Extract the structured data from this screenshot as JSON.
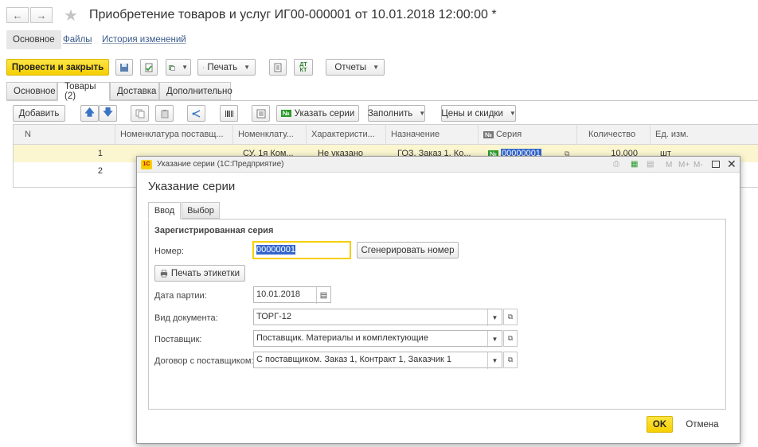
{
  "window": {
    "title": "Приобретение товаров и услуг ИГ00-000001 от 10.01.2018 12:00:00 *"
  },
  "nav_links": [
    "Основное",
    "Файлы",
    "История изменений"
  ],
  "toolbar": {
    "post_close": "Провести и закрыть",
    "print": "Печать",
    "reports": "Отчеты"
  },
  "tabs": [
    "Основное",
    "Товары (2)",
    "Доставка",
    "Дополнительно"
  ],
  "grid_toolbar": {
    "add": "Добавить",
    "specify_series": "Указать серии",
    "fill": "Заполнить",
    "prices_discounts": "Цены и скидки"
  },
  "grid": {
    "columns": [
      "N",
      "Номенклатура поставщ...",
      "Номенклату...",
      "Характеристи...",
      "Назначение",
      "Серия",
      "Количество",
      "Ед. изм."
    ],
    "rows": [
      [
        "1",
        "",
        "СУ, 1я Ком...",
        "Не указано",
        "ГОЗ, Заказ 1, Ко...",
        "00000001",
        "10,000",
        "шт"
      ],
      [
        "2",
        "",
        "",
        "",
        "",
        "",
        "",
        ""
      ]
    ]
  },
  "dialog": {
    "window_title": "Указание серии (1С:Предприятие)",
    "window_controls": [
      "M",
      "M+",
      "M-"
    ],
    "heading": "Указание серии",
    "tabs": [
      "Ввод",
      "Выбор"
    ],
    "section": "Зарегистрированная серия",
    "number_label": "Номер:",
    "number_value": "00000001",
    "generate_button": "Сгенерировать номер",
    "print_labels_button": "Печать этикетки",
    "batch_date_label": "Дата партии:",
    "batch_date_value": "10.01.2018",
    "doc_type_label": "Вид документа:",
    "doc_type_value": "ТОРГ-12",
    "supplier_label": "Поставщик:",
    "supplier_value": "Поставщик. Материалы и комплектующие",
    "contract_label": "Договор с поставщиком:",
    "contract_value": "С поставщиком. Заказ 1, Контракт 1, Заказчик 1",
    "ok": "OK",
    "cancel": "Отмена"
  },
  "colors": {
    "accent_yellow": "#f5cf00",
    "selected_row": "#fbf6d0",
    "selection_blue": "#3366cc"
  }
}
